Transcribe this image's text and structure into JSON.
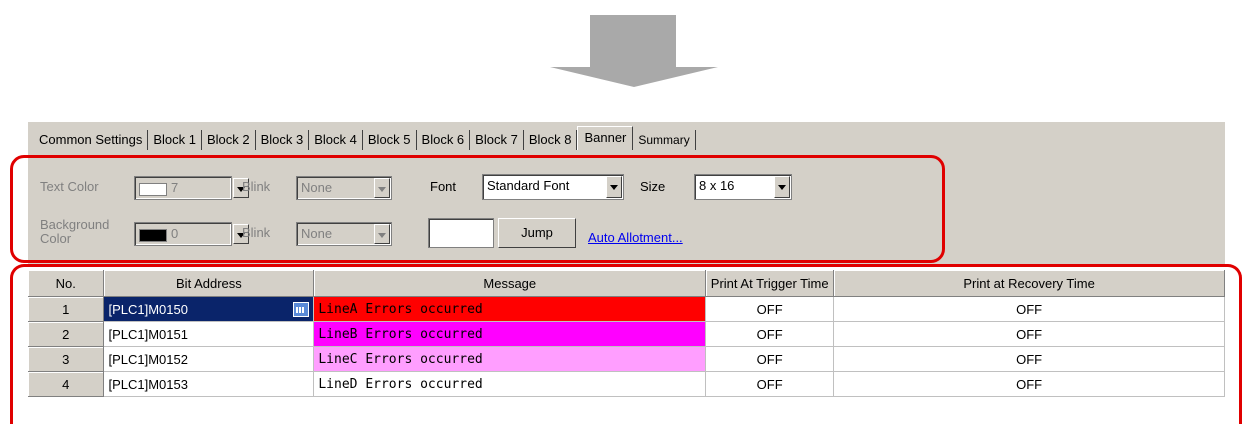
{
  "tabs": [
    "Common Settings",
    "Block 1",
    "Block 2",
    "Block 3",
    "Block 4",
    "Block 5",
    "Block 6",
    "Block 7",
    "Block 8",
    "Banner",
    "Summary"
  ],
  "active_tab": "Banner",
  "settings": {
    "text_color_label": "Text Color",
    "text_color_value": "7",
    "text_color_swatch": "#ffffff",
    "blink_label": "Blink",
    "text_blink_value": "None",
    "background_label_1": "Background",
    "background_label_2": "Color",
    "background_color_value": "0",
    "background_color_swatch": "#000000",
    "bg_blink_value": "None",
    "font_label": "Font",
    "font_value": "Standard Font",
    "size_label": "Size",
    "size_value": "8 x 16",
    "jump_input": "",
    "jump_button": "Jump",
    "auto_allotment_link": "Auto Allotment..."
  },
  "grid": {
    "columns": [
      "No.",
      "Bit Address",
      "Message",
      "Print At Trigger Time",
      "Print at Recovery Time"
    ],
    "rows": [
      {
        "no": "1",
        "address": "[PLC1]M0150",
        "message": "LineA Errors occurred",
        "color": "#ff0000",
        "trigger": "OFF",
        "recovery": "OFF"
      },
      {
        "no": "2",
        "address": "[PLC1]M0151",
        "message": "LineB Errors occurred",
        "color": "#ff00ff",
        "trigger": "OFF",
        "recovery": "OFF"
      },
      {
        "no": "3",
        "address": "[PLC1]M0152",
        "message": "LineC Errors occurred",
        "color": "#ff9eff",
        "trigger": "OFF",
        "recovery": "OFF"
      },
      {
        "no": "4",
        "address": "[PLC1]M0153",
        "message": "LineD Errors occurred",
        "color": "#ffffff",
        "trigger": "OFF",
        "recovery": "OFF"
      }
    ]
  },
  "colors": {
    "highlight": "#e00000",
    "arrow": "#a9a9a9",
    "selection": "#0a246a"
  }
}
